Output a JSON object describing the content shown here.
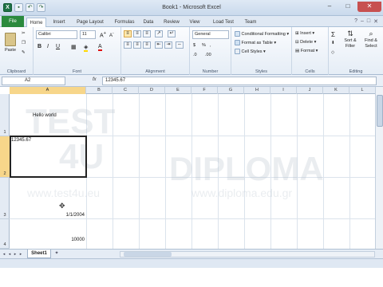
{
  "window": {
    "title": "Book1 - Microsoft Excel"
  },
  "colors": {
    "file_tab": "#2b8a3e",
    "selection_header": "#f7d68a",
    "ribbon_bg": "#e5edf6"
  },
  "tabs": [
    "File",
    "Home",
    "Insert",
    "Page Layout",
    "Formulas",
    "Data",
    "Review",
    "View",
    "Load Test",
    "Team"
  ],
  "ribbon": {
    "clipboard": {
      "label": "Clipboard",
      "paste": "Paste"
    },
    "font": {
      "label": "Font",
      "name": "Calibri",
      "size": "11",
      "bold": "B",
      "italic": "I",
      "underline": "U"
    },
    "alignment": {
      "label": "Alignment"
    },
    "number": {
      "label": "Number",
      "format": "General",
      "currency": "$",
      "percent": "%",
      "comma": ",",
      "inc_decimal": ".0",
      "dec_decimal": ".00"
    },
    "styles": {
      "label": "Styles",
      "conditional": "Conditional Formatting",
      "format_table": "Format as Table",
      "cell_styles": "Cell Styles"
    },
    "cells": {
      "label": "Cells",
      "insert": "Insert",
      "delete": "Delete",
      "format": "Format"
    },
    "editing": {
      "label": "Editing",
      "sort_filter": "Sort & Filter",
      "find_select": "Find & Select",
      "sum_symbol": "Σ"
    }
  },
  "formula_bar": {
    "name_box": "A2",
    "fx": "fx",
    "value": "12345.67"
  },
  "columns": [
    "A",
    "B",
    "C",
    "D",
    "E",
    "F",
    "G",
    "H",
    "I",
    "J",
    "K",
    "L"
  ],
  "rows": [
    "1",
    "2",
    "3",
    "4"
  ],
  "cells": {
    "a1": "Hello world",
    "a2": "12345.67",
    "a3": "1/1/2004",
    "a4": "10000"
  },
  "sheets": [
    "Sheet1"
  ],
  "watermark": {
    "logo1": "TEST",
    "logo2": "4U",
    "url1": "www.test4u.eu",
    "brand": "DIPLOMA",
    "url2": "www.diploma.edu.gr"
  }
}
